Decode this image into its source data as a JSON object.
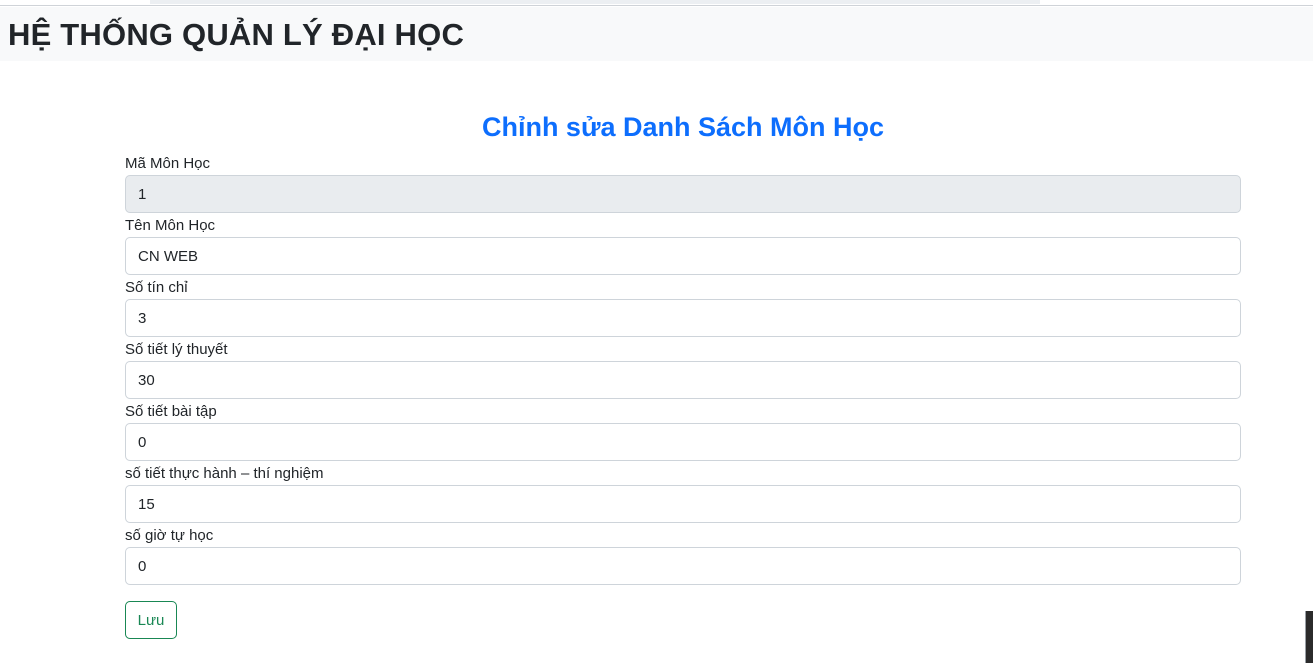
{
  "header": {
    "title": "HỆ THỐNG QUẢN LÝ ĐẠI HỌC"
  },
  "page": {
    "title": "Chỉnh sửa Danh Sách Môn Học"
  },
  "form": {
    "fields": [
      {
        "label": "Mã Môn Học",
        "value": "1"
      },
      {
        "label": "Tên Môn Học",
        "value": "CN WEB"
      },
      {
        "label": "Số tín chỉ",
        "value": "3"
      },
      {
        "label": "Số tiết lý thuyết",
        "value": "30"
      },
      {
        "label": "Số tiết bài tập",
        "value": "0"
      },
      {
        "label": "số tiết thực hành – thí nghiệm",
        "value": "15"
      },
      {
        "label": "số giờ tự học",
        "value": "0"
      }
    ],
    "save_label": "Lưu"
  },
  "colors": {
    "title_blue": "#0d6efd",
    "button_green": "#198754",
    "readonly_gray": "#e9ecef"
  }
}
